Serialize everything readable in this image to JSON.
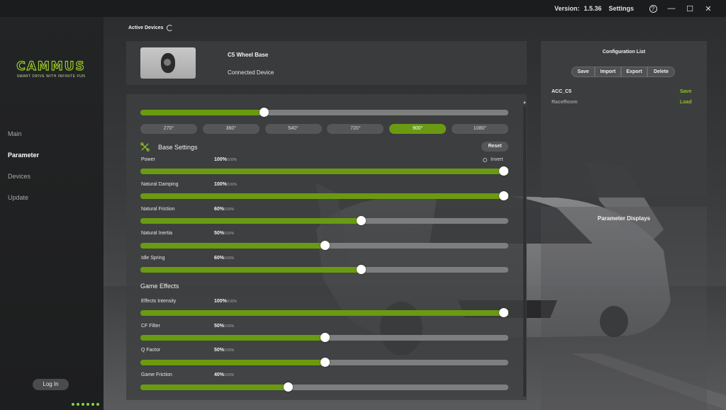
{
  "topbar": {
    "version_label": "Version:",
    "version_value": "1.5.36",
    "settings_label": "Settings",
    "help_glyph": "?",
    "minimize_glyph": "—",
    "maximize_glyph": "☐",
    "close_glyph": "✕"
  },
  "brand": {
    "logo_text": "CAMMUS",
    "tagline": "SMART DRIVE WITH INFINITE FUN",
    "accent_color": "#9ccc2a"
  },
  "nav": {
    "items": [
      {
        "label": "Main"
      },
      {
        "label": "Parameter"
      },
      {
        "label": "Devices"
      },
      {
        "label": "Update"
      }
    ],
    "active": "Parameter"
  },
  "login_label": "Log In",
  "active_devices_label": "Active Devices",
  "device": {
    "name": "C5 Wheel Base",
    "status": "Connected Device"
  },
  "rotation": {
    "slider_fraction": 0.335,
    "options": [
      "270°",
      "360°",
      "540°",
      "720°",
      "900°",
      "1080°"
    ],
    "selected": "900°"
  },
  "base_settings": {
    "title": "Base Settings",
    "reset_label": "Reset",
    "invert_label": "Invert",
    "params": [
      {
        "label": "Power",
        "value": "100%",
        "max": "/100%",
        "level": 1.0
      },
      {
        "label": "Natural Damping",
        "value": "100%",
        "max": "/100%",
        "level": 1.0
      },
      {
        "label": "Natural Friction",
        "value": "60%",
        "max": "/100%",
        "level": 0.6
      },
      {
        "label": "Natural Inertia",
        "value": "50%",
        "max": "/100%",
        "level": 0.5
      },
      {
        "label": "Idle Spring",
        "value": "60%",
        "max": "/100%",
        "level": 0.6
      }
    ]
  },
  "game_effects": {
    "title": "Game Effects",
    "params": [
      {
        "label": "Effects Intensity",
        "value": "100%",
        "max": "/100%",
        "level": 1.0
      },
      {
        "label": "CF Filter",
        "value": "50%",
        "max": "/100%",
        "level": 0.5
      },
      {
        "label": "Q Factor",
        "value": "50%",
        "max": "/100%",
        "level": 0.5
      },
      {
        "label": "Game Friction",
        "value": "40%",
        "max": "/100%",
        "level": 0.4
      }
    ]
  },
  "config": {
    "title": "Configuration List",
    "buttons": [
      "Save",
      "Import",
      "Export",
      "Delete"
    ],
    "entries": [
      {
        "name": "ACC_C5",
        "action": "Save",
        "active": true
      },
      {
        "name": "RaceRoom",
        "action": "Load",
        "active": false
      }
    ]
  },
  "parameter_displays_title": "Parameter Displays",
  "colors": {
    "accent_green": "#6a9a12",
    "action_green": "#8fc21f"
  }
}
